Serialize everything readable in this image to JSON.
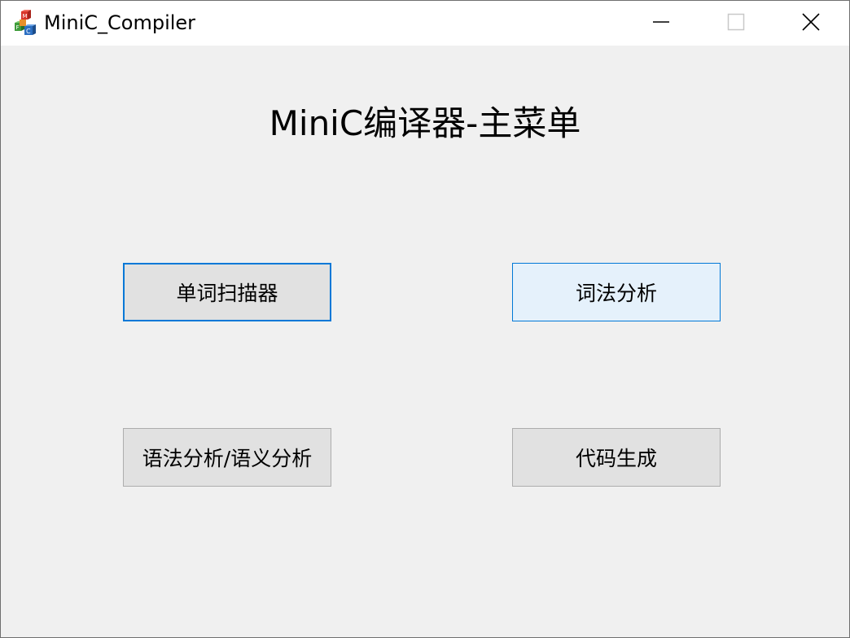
{
  "window": {
    "title": "MiniC_Compiler",
    "icon": "minic-blocks-icon"
  },
  "caption_buttons": {
    "minimize_icon": "minimize-icon",
    "maximize_icon": "maximize-icon",
    "close_icon": "close-icon"
  },
  "main": {
    "heading": "MiniC编译器-主菜单",
    "buttons": {
      "word_scanner": "单词扫描器",
      "lexical_analysis": "词法分析",
      "syntax_semantic_analysis": "语法分析/语义分析",
      "code_generation": "代码生成"
    }
  },
  "colors": {
    "focus_border": "#0078d7",
    "hover_background": "#e5f1fb",
    "button_background": "#e1e1e1",
    "client_background": "#f0f0f0"
  }
}
